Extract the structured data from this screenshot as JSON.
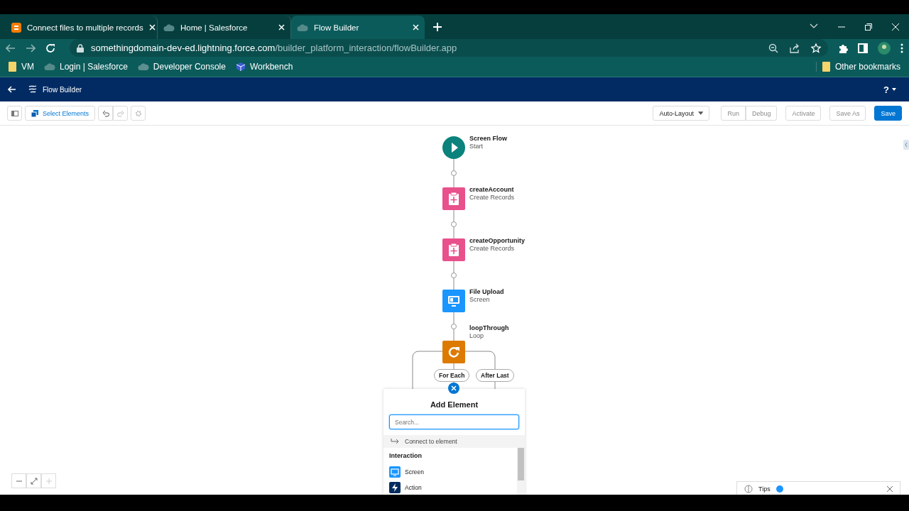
{
  "browser": {
    "tabs": [
      {
        "title": "Connect files to multiple records",
        "selected": false
      },
      {
        "title": "Home | Salesforce",
        "selected": false
      },
      {
        "title": "Flow Builder",
        "selected": true
      }
    ],
    "url": {
      "domain": "somethingdomain-dev-ed.lightning.force.com",
      "path": "/builder_platform_interaction/flowBuilder.app"
    },
    "bookmarks": [
      {
        "label": "VM"
      },
      {
        "label": "Login | Salesforce"
      },
      {
        "label": "Developer Console"
      },
      {
        "label": "Workbench"
      }
    ],
    "other_bookmarks": "Other bookmarks"
  },
  "app": {
    "title": "Flow Builder",
    "help": "?"
  },
  "toolbar": {
    "select_elements": "Select Elements",
    "layout": "Auto-Layout",
    "buttons": [
      {
        "label": "Run",
        "disabled": true,
        "kind": "neutral"
      },
      {
        "label": "Debug",
        "disabled": true,
        "kind": "neutral"
      },
      {
        "label": "Activate",
        "disabled": true,
        "kind": "neutral"
      },
      {
        "label": "Save As",
        "disabled": true,
        "kind": "neutral"
      },
      {
        "label": "Save",
        "disabled": false,
        "kind": "brand"
      }
    ]
  },
  "flow": {
    "nodes": [
      {
        "kind": "start",
        "name": "Screen Flow",
        "type": "Start"
      },
      {
        "kind": "create",
        "name": "createAccount",
        "type": "Create Records"
      },
      {
        "kind": "create",
        "name": "createOpportunity",
        "type": "Create Records"
      },
      {
        "kind": "screen",
        "name": "File Upload",
        "type": "Screen"
      },
      {
        "kind": "loop",
        "name": "loopThrough",
        "type": "Loop"
      }
    ],
    "loop_branches": [
      "For Each",
      "After Last"
    ]
  },
  "add_element": {
    "title": "Add Element",
    "search_placeholder": "Search...",
    "connect": "Connect to element",
    "section": "Interaction",
    "items": [
      {
        "label": "Screen",
        "kind": "screen"
      },
      {
        "label": "Action",
        "kind": "action"
      }
    ]
  },
  "tips": {
    "label": "Tips"
  }
}
